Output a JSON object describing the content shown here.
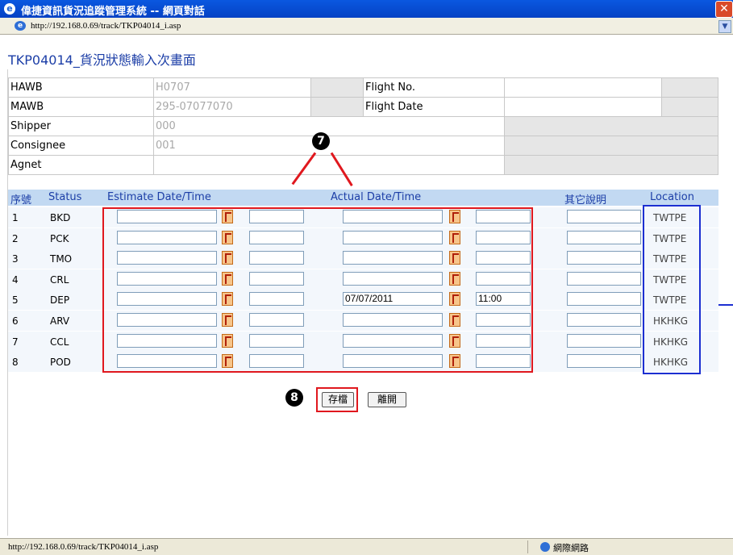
{
  "window": {
    "title": "偉捷資訊貨況追蹤管理系統 -- 網頁對話",
    "close": "✕"
  },
  "address": {
    "url": "http://192.168.0.69/track/TKP04014_i.asp"
  },
  "page_title": "TKP04014_貨況狀態輸入次畫面",
  "header_fields": {
    "hawb_label": "HAWB",
    "hawb_value": "H0707",
    "flight_no_label": "Flight No.",
    "flight_no_value": "",
    "mawb_label": "MAWB",
    "mawb_value": "295-07077070",
    "flight_date_label": "Flight Date",
    "flight_date_value": "",
    "shipper_label": "Shipper",
    "shipper_value": "000",
    "consignee_label": "Consignee",
    "consignee_value": "001",
    "agnet_label": "Agnet",
    "agnet_value": ""
  },
  "columns": {
    "seq": "序號",
    "status": "Status",
    "estimate": "Estimate Date/Time",
    "actual": "Actual Date/Time",
    "other": "其它說明",
    "location": "Location"
  },
  "rows": [
    {
      "seq": "1",
      "status": "BKD",
      "actual_date": "",
      "actual_time": "",
      "location": "TWTPE"
    },
    {
      "seq": "2",
      "status": "PCK",
      "actual_date": "",
      "actual_time": "",
      "location": "TWTPE"
    },
    {
      "seq": "3",
      "status": "TMO",
      "actual_date": "",
      "actual_time": "",
      "location": "TWTPE"
    },
    {
      "seq": "4",
      "status": "CRL",
      "actual_date": "",
      "actual_time": "",
      "location": "TWTPE"
    },
    {
      "seq": "5",
      "status": "DEP",
      "actual_date": "07/07/2011",
      "actual_time": "11:00",
      "location": "TWTPE"
    },
    {
      "seq": "6",
      "status": "ARV",
      "actual_date": "",
      "actual_time": "",
      "location": "HKHKG"
    },
    {
      "seq": "7",
      "status": "CCL",
      "actual_date": "",
      "actual_time": "",
      "location": "HKHKG"
    },
    {
      "seq": "8",
      "status": "POD",
      "actual_date": "",
      "actual_time": "",
      "location": "HKHKG"
    }
  ],
  "callouts": {
    "seven": "7",
    "eight": "8"
  },
  "buttons": {
    "save": "存檔",
    "leave": "離開"
  },
  "statusbar": {
    "url": "http://192.168.0.69/track/TKP04014_i.asp",
    "zone": "網際網路"
  },
  "colors": {
    "title_blue": "#0a58e0",
    "header_row": "#c2d9f2",
    "annotation_red": "#e0181e",
    "annotation_blue": "#1c2fd1"
  }
}
